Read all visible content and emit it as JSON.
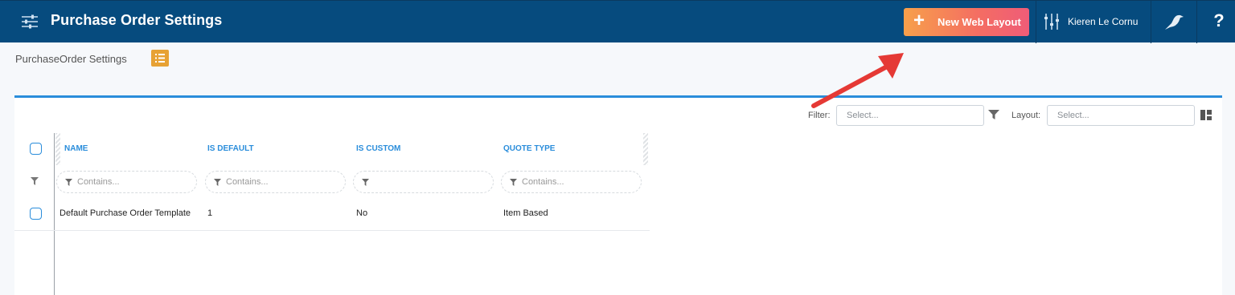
{
  "header": {
    "title": "Purchase Order Settings",
    "new_layout_label": "New Web Layout",
    "user_name": "Kieren Le Cornu",
    "help_label": "?"
  },
  "breadcrumb": {
    "label": "PurchaseOrder Settings"
  },
  "toolbar": {
    "filter_label": "Filter:",
    "filter_placeholder": "Select...",
    "layout_label": "Layout:",
    "layout_placeholder": "Select..."
  },
  "grid": {
    "columns": [
      "NAME",
      "IS DEFAULT",
      "IS CUSTOM",
      "QUOTE TYPE"
    ],
    "filters": [
      "Contains...",
      "Contains...",
      "",
      "Contains..."
    ],
    "rows": [
      {
        "name": "Default Purchase Order Template",
        "is_default": "1",
        "is_custom": "No",
        "quote_type": "Item Based"
      }
    ]
  },
  "colors": {
    "header_bg": "#064b7e",
    "accent_blue": "#2a8ddb",
    "list_button": "#e7a234",
    "annotation_arrow": "#e53935"
  },
  "icons": [
    "settings-sliders-icon",
    "plus-icon",
    "user-sliders-icon",
    "bird-icon",
    "help-icon",
    "list-icon",
    "funnel-icon",
    "layout-grid-icon"
  ]
}
